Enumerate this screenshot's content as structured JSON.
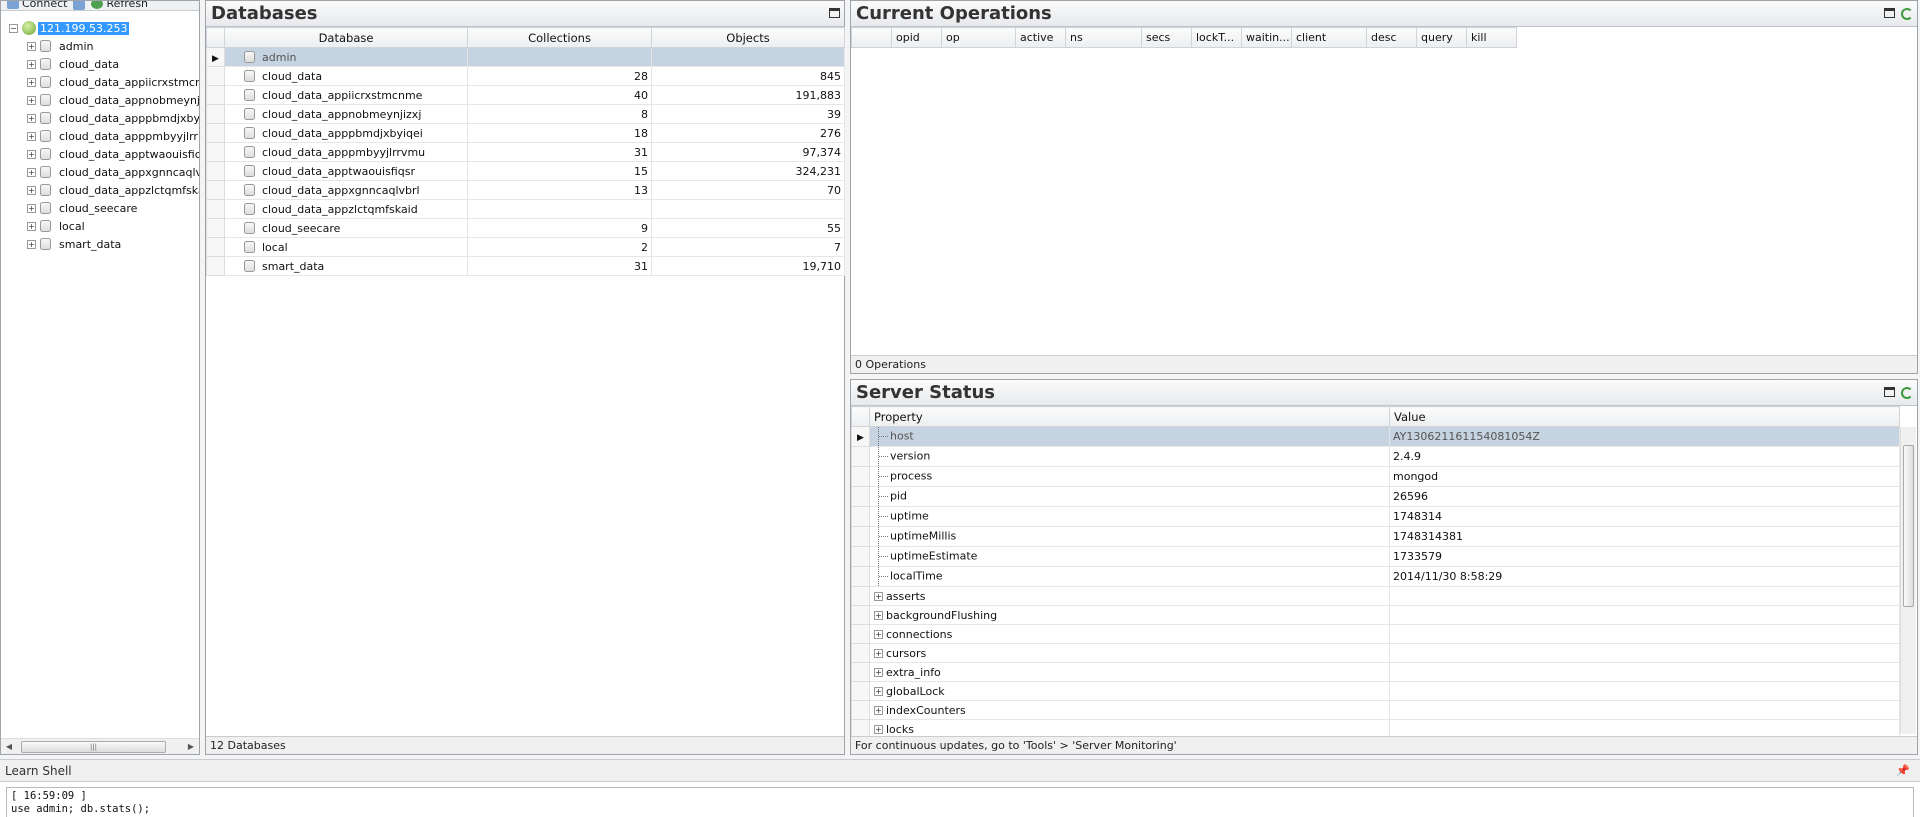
{
  "toolbar": {
    "connect_label": "Connect",
    "refresh_label": "Refresh"
  },
  "tree": {
    "server": "121.199.53.253",
    "databases": [
      "admin",
      "cloud_data",
      "cloud_data_appiicrxstmcn",
      "cloud_data_appnobmeynj",
      "cloud_data_apppbmdjxby",
      "cloud_data_apppmbyyjlrr",
      "cloud_data_apptwaouisfic",
      "cloud_data_appxgnncaqlv",
      "cloud_data_appzlctqmfska",
      "cloud_seecare",
      "local",
      "smart_data"
    ]
  },
  "databases_panel": {
    "title": "Databases",
    "columns": [
      "Database",
      "Collections",
      "Objects"
    ],
    "rows": [
      {
        "name": "admin",
        "collections": "",
        "objects": ""
      },
      {
        "name": "cloud_data",
        "collections": "28",
        "objects": "845"
      },
      {
        "name": "cloud_data_appiicrxstmcnme",
        "collections": "40",
        "objects": "191,883"
      },
      {
        "name": "cloud_data_appnobmeynjizxj",
        "collections": "8",
        "objects": "39"
      },
      {
        "name": "cloud_data_apppbmdjxbyiqei",
        "collections": "18",
        "objects": "276"
      },
      {
        "name": "cloud_data_apppmbyyjlrrvmu",
        "collections": "31",
        "objects": "97,374"
      },
      {
        "name": "cloud_data_apptwaouisfiqsr",
        "collections": "15",
        "objects": "324,231"
      },
      {
        "name": "cloud_data_appxgnncaqlvbrl",
        "collections": "13",
        "objects": "70"
      },
      {
        "name": "cloud_data_appzlctqmfskaid",
        "collections": "",
        "objects": ""
      },
      {
        "name": "cloud_seecare",
        "collections": "9",
        "objects": "55"
      },
      {
        "name": "local",
        "collections": "2",
        "objects": "7"
      },
      {
        "name": "smart_data",
        "collections": "31",
        "objects": "19,710"
      }
    ],
    "footer": "12 Databases"
  },
  "ops_panel": {
    "title": "Current Operations",
    "columns": [
      "opid",
      "op",
      "active",
      "ns",
      "secs",
      "lockT...",
      "waitin...",
      "client",
      "desc",
      "query",
      "kill"
    ],
    "footer": "0 Operations"
  },
  "status_panel": {
    "title": "Server Status",
    "columns": [
      "Property",
      "Value"
    ],
    "rows": [
      {
        "prop": "host",
        "value": "AY130621161154081054Z",
        "expandable": false
      },
      {
        "prop": "version",
        "value": "2.4.9",
        "expandable": false
      },
      {
        "prop": "process",
        "value": "mongod",
        "expandable": false
      },
      {
        "prop": "pid",
        "value": "26596",
        "expandable": false
      },
      {
        "prop": "uptime",
        "value": "1748314",
        "expandable": false
      },
      {
        "prop": "uptimeMillis",
        "value": "1748314381",
        "expandable": false
      },
      {
        "prop": "uptimeEstimate",
        "value": "1733579",
        "expandable": false
      },
      {
        "prop": "localTime",
        "value": "2014/11/30 8:58:29",
        "expandable": false
      },
      {
        "prop": "asserts",
        "value": "",
        "expandable": true
      },
      {
        "prop": "backgroundFlushing",
        "value": "",
        "expandable": true
      },
      {
        "prop": "connections",
        "value": "",
        "expandable": true
      },
      {
        "prop": "cursors",
        "value": "",
        "expandable": true
      },
      {
        "prop": "extra_info",
        "value": "",
        "expandable": true
      },
      {
        "prop": "globalLock",
        "value": "",
        "expandable": true
      },
      {
        "prop": "indexCounters",
        "value": "",
        "expandable": true
      },
      {
        "prop": "locks",
        "value": "",
        "expandable": true
      }
    ],
    "footer": "For continuous updates, go to 'Tools' > 'Server Monitoring'"
  },
  "shell": {
    "title": "Learn Shell",
    "lines": [
      "[ 16:59:09 ]",
      "use admin; db.stats();"
    ]
  }
}
